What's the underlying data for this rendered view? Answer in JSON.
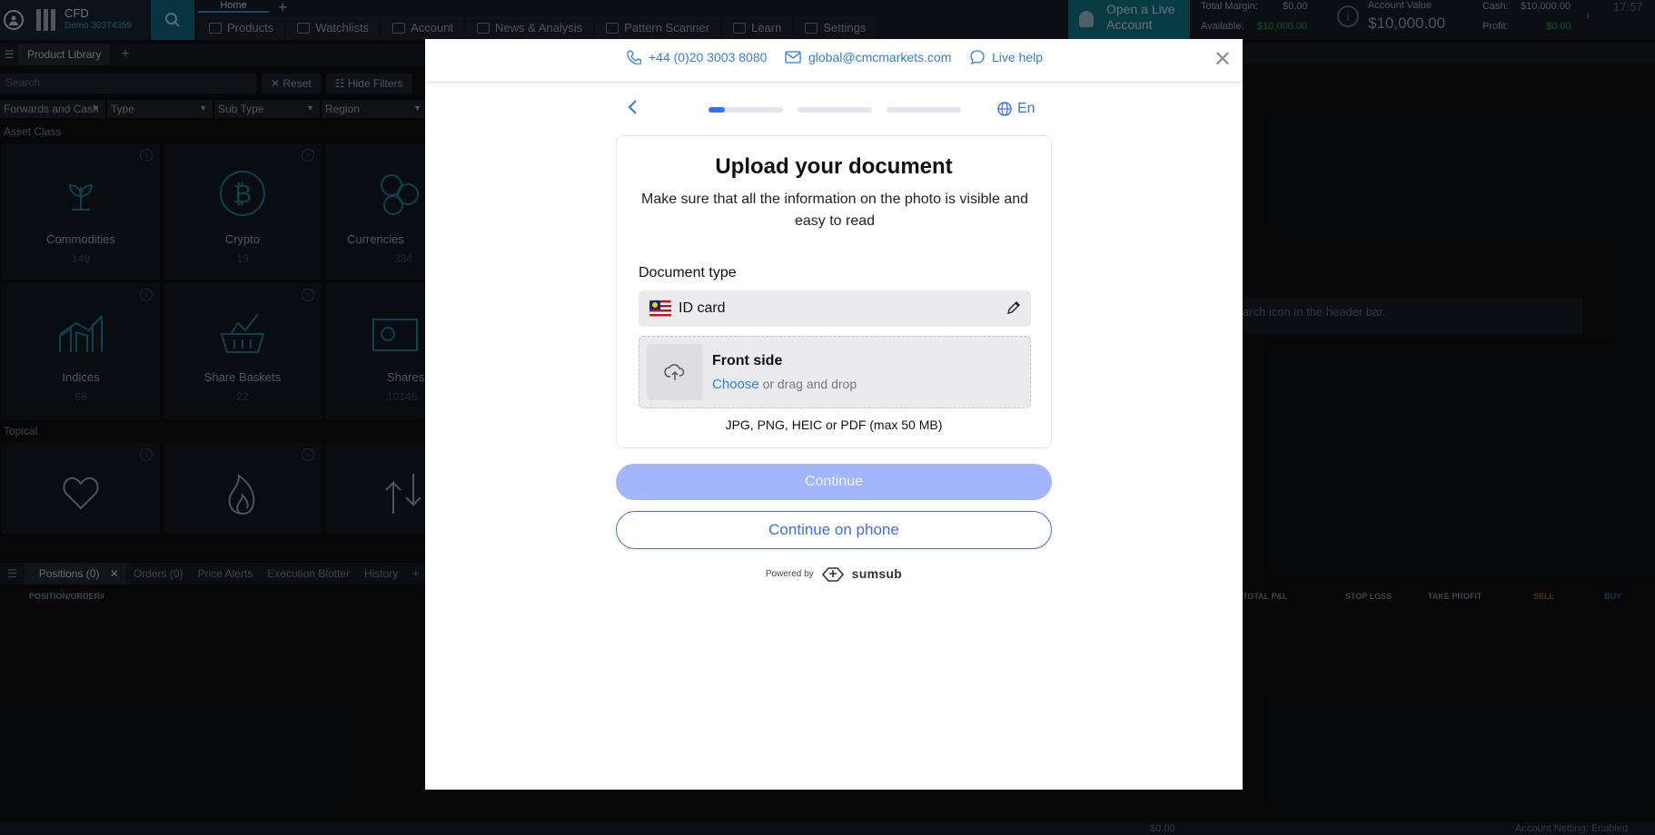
{
  "app": {
    "account_type": "CFD",
    "account_id": "Demo 30374359",
    "home_tab": "Home",
    "nav": [
      "Products",
      "Watchlists",
      "Account",
      "News & Analysis",
      "Pattern Scanner",
      "Learn",
      "Settings"
    ],
    "open_live_label": "Open a Live Account",
    "stats": {
      "total_margin_label": "Total Margin:",
      "total_margin": "$0.00",
      "available_label": "Available:",
      "available": "$10,000.00",
      "account_value_label": "Account Value",
      "account_value": "$10,000.00",
      "cash_label": "Cash:",
      "cash": "$10,000.00",
      "profit_label": "Profit:",
      "profit": "$0.00",
      "time": "17:57"
    }
  },
  "library": {
    "title": "Product Library",
    "search_placeholder": "Search",
    "reset_label": "Reset",
    "hide_filters_label": "Hide Filters",
    "filters": [
      "Forwards and Cash",
      "Type",
      "Sub Type",
      "Region"
    ],
    "asset_class_label": "Asset Class",
    "topical_label": "Topical",
    "tiles": [
      {
        "name": "Commodities",
        "count": "149"
      },
      {
        "name": "Crypto",
        "count": "19"
      },
      {
        "name": "Currencies",
        "count": "334"
      },
      {
        "name": "Indices",
        "count": "68"
      },
      {
        "name": "Share Baskets",
        "count": "22"
      },
      {
        "name": "Shares",
        "count": "10146"
      }
    ]
  },
  "bottom": {
    "tabs": [
      "Positions (0)",
      "Orders (0)",
      "Price Alerts",
      "Execution Blotter",
      "History"
    ],
    "columns": [
      "POSITION/ORDER#",
      "TOTAL P&L",
      "STOP LOSS",
      "TAKE PROFIT",
      "SELL",
      "BUY"
    ],
    "right_message": "arch icon in the header bar.",
    "footer_value": "$0.00",
    "footer_netting": "Account Netting: Enabled"
  },
  "modal": {
    "phone": "+44 (0)20 3003 8080",
    "email": "global@cmcmarkets.com",
    "live_help": "Live help",
    "language": "En",
    "progress_steps": 3,
    "progress_current_fraction": 0.25,
    "title": "Upload your document",
    "subtitle": "Make sure that all the information on the photo is visible and easy to read",
    "doc_type_label": "Document type",
    "doc_type_value": "ID card",
    "front_side": "Front side",
    "choose": "Choose",
    "drag_drop": "or drag and drop",
    "formats": "JPG, PNG, HEIC or PDF (max 50 MB)",
    "continue_label": "Continue",
    "continue_phone_label": "Continue on phone",
    "powered_by": "Powered by",
    "brand": "sumsub",
    "colors": {
      "primary": "#3d6ef0",
      "primary_disabled": "#a3b5fb",
      "link": "#2f7fd6"
    }
  }
}
